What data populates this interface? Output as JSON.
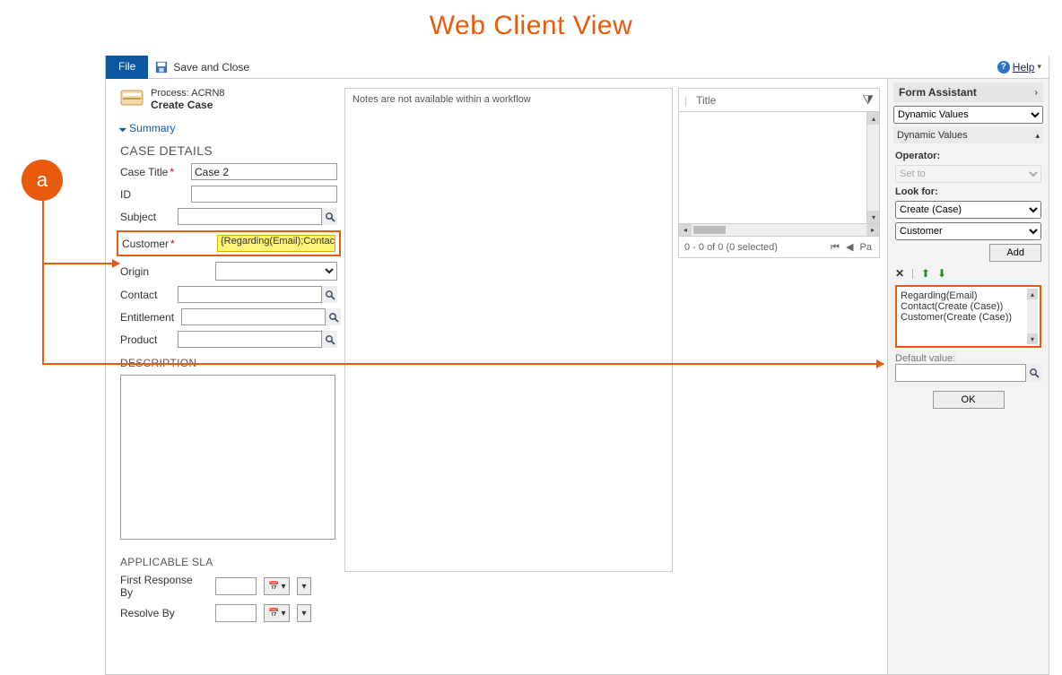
{
  "doc_title": "Web Client View",
  "annotation_badge": "a",
  "toolbar": {
    "file_label": "File",
    "save_close_label": "Save and Close",
    "help_label": "Help"
  },
  "process": {
    "label": "Process: ACRN8",
    "name": "Create Case"
  },
  "summary_link": "Summary",
  "case_details": {
    "heading": "CASE DETAILS",
    "fields": {
      "case_title_label": "Case Title",
      "case_title_value": "Case 2",
      "id_label": "ID",
      "id_value": "",
      "subject_label": "Subject",
      "subject_value": "",
      "customer_label": "Customer",
      "customer_value": "{Regarding(Email);Contact(Cr",
      "origin_label": "Origin",
      "contact_label": "Contact",
      "entitlement_label": "Entitlement",
      "product_label": "Product"
    }
  },
  "description_heading": "DESCRIPTION",
  "sla": {
    "heading": "APPLICABLE SLA",
    "first_label": "First Response By",
    "resolve_label": "Resolve By"
  },
  "notes_placeholder": "Notes are not available within a workflow",
  "subgrid": {
    "title_col": "Title",
    "pager_status": "0 - 0 of 0 (0 selected)",
    "pager_page": "Pa"
  },
  "form_assistant": {
    "heading": "Form Assistant",
    "mode": "Dynamic Values",
    "sub_heading": "Dynamic Values",
    "operator_label": "Operator:",
    "operator_value": "Set to",
    "lookfor_label": "Look for:",
    "lookfor_entity": "Create (Case)",
    "lookfor_attr": "Customer",
    "add_label": "Add",
    "list_items": [
      "Regarding(Email)",
      "Contact(Create (Case))",
      "Customer(Create (Case))"
    ],
    "default_label": "Default value:",
    "ok_label": "OK"
  }
}
